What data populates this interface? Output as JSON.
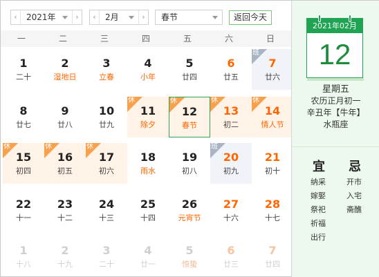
{
  "toolbar": {
    "year_value": "2021年",
    "month_value": "2月",
    "festival_value": "春节",
    "today_button": "返回今天",
    "prev_arrow": "‹",
    "next_arrow": "›"
  },
  "weekdays": [
    "一",
    "二",
    "三",
    "四",
    "五",
    "六",
    "日"
  ],
  "weeks": [
    [
      {
        "day": "1",
        "lunar": "二十"
      },
      {
        "day": "2",
        "lunar": "湿地日",
        "fest": true
      },
      {
        "day": "3",
        "lunar": "立春",
        "fest": true
      },
      {
        "day": "4",
        "lunar": "小年",
        "fest": true
      },
      {
        "day": "5",
        "lunar": "廿四"
      },
      {
        "day": "6",
        "lunar": "廿五",
        "we": true
      },
      {
        "day": "7",
        "lunar": "廿六",
        "we": true,
        "work": true,
        "tag": "班"
      }
    ],
    [
      {
        "day": "8",
        "lunar": "廿七"
      },
      {
        "day": "9",
        "lunar": "廿八"
      },
      {
        "day": "10",
        "lunar": "廿九"
      },
      {
        "day": "11",
        "lunar": "除夕",
        "fest": true,
        "hl": true,
        "tag": "休"
      },
      {
        "day": "12",
        "lunar": "春节",
        "fest": true,
        "hl": true,
        "tag": "休",
        "sel": true
      },
      {
        "day": "13",
        "lunar": "初二",
        "we": true,
        "hl": true,
        "tag": "休"
      },
      {
        "day": "14",
        "lunar": "情人节",
        "fest": true,
        "we": true,
        "hl": true,
        "tag": "休"
      }
    ],
    [
      {
        "day": "15",
        "lunar": "初四",
        "hl": true,
        "tag": "休"
      },
      {
        "day": "16",
        "lunar": "初五",
        "hl": true,
        "tag": "休"
      },
      {
        "day": "17",
        "lunar": "初六",
        "hl": true,
        "tag": "休"
      },
      {
        "day": "18",
        "lunar": "雨水",
        "fest": true
      },
      {
        "day": "19",
        "lunar": "初八"
      },
      {
        "day": "20",
        "lunar": "初九",
        "we": true,
        "work": true,
        "tag": "班"
      },
      {
        "day": "21",
        "lunar": "初十",
        "we": true
      }
    ],
    [
      {
        "day": "22",
        "lunar": "十一"
      },
      {
        "day": "23",
        "lunar": "十二"
      },
      {
        "day": "24",
        "lunar": "十三"
      },
      {
        "day": "25",
        "lunar": "十四"
      },
      {
        "day": "26",
        "lunar": "元宵节",
        "fest": true
      },
      {
        "day": "27",
        "lunar": "十六",
        "we": true
      },
      {
        "day": "28",
        "lunar": "十七",
        "we": true
      }
    ],
    [
      {
        "day": "1",
        "lunar": "十八",
        "other": true
      },
      {
        "day": "2",
        "lunar": "十九",
        "other": true
      },
      {
        "day": "3",
        "lunar": "二十",
        "other": true
      },
      {
        "day": "4",
        "lunar": "廿一",
        "other": true
      },
      {
        "day": "5",
        "lunar": "惊蛰",
        "fest": true,
        "other": true
      },
      {
        "day": "6",
        "lunar": "廿三",
        "we": true,
        "other": true
      },
      {
        "day": "7",
        "lunar": "廿四",
        "we": true,
        "other": true
      }
    ]
  ],
  "panel": {
    "card_header": "2021年02月",
    "card_day": "12",
    "weekday": "星期五",
    "lunar_date": "农历正月初一",
    "ganzhi": "辛丑年【牛年】",
    "zodiac_sign": "水瓶座",
    "yi_title": "宜",
    "ji_title": "忌",
    "yi_items": [
      "纳采",
      "嫁娶",
      "祭祀",
      "祈福",
      "出行"
    ],
    "ji_items": [
      "开市",
      "入宅",
      "斋醮"
    ]
  },
  "colors": {
    "accent_green": "#20a453",
    "weekend_orange": "#ff6600",
    "holiday_tag": "#f7a14d",
    "work_tag": "#a9b4c2"
  },
  "icons": {
    "prev": "chevron-left-icon",
    "next": "chevron-right-icon",
    "dropdown": "caret-down-icon"
  }
}
